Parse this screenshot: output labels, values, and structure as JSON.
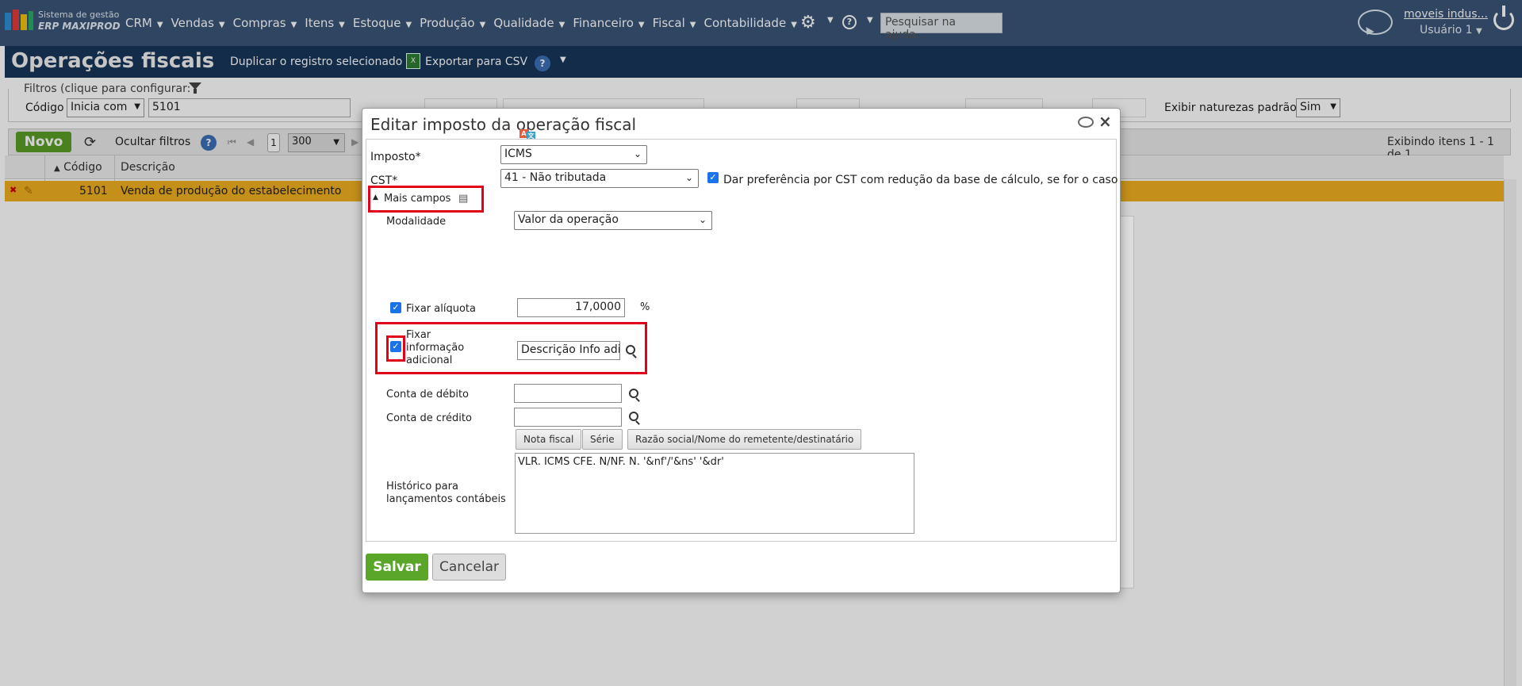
{
  "app": {
    "logo_line1": "Sistema de gestão",
    "logo_line2": "ERP MAXIPROD",
    "menu": [
      "CRM",
      "Vendas",
      "Compras",
      "Itens",
      "Estoque",
      "Produção",
      "Qualidade",
      "Financeiro",
      "Fiscal",
      "Contabilidade"
    ],
    "help_search_placeholder": "Pesquisar na ajuda...",
    "company": "moveis indus...",
    "user": "Usuário 1"
  },
  "page": {
    "title": "Operações fiscais",
    "duplicate": "Duplicar o registro selecionado",
    "export_csv": "Exportar para CSV"
  },
  "filters": {
    "legend": "Filtros (clique para configurar:",
    "code_label": "Código",
    "code_op": "Inicia com",
    "code_value": "5101",
    "natureza_label": "Exibir naturezas padrão",
    "natureza_value": "Sim"
  },
  "toolbar": {
    "new": "Novo",
    "hide_filters": "Ocultar filtros",
    "page": "1",
    "per_page": "300",
    "showing": "Exibindo itens 1 - 1 de 1"
  },
  "table": {
    "col_code": "Código",
    "col_desc": "Descrição",
    "rows": [
      {
        "code": "5101",
        "desc": "Venda de produção do estabelecimento"
      }
    ]
  },
  "dialog": {
    "title": "Editar imposto da operação fiscal",
    "imposto_label": "Imposto*",
    "imposto_value": "ICMS",
    "cst_label": "CST*",
    "cst_value": "41 - Não tributada",
    "cst_pref": "Dar preferência por CST com redução da base de cálculo, se for o caso",
    "more_fields": "Mais campos",
    "modalidade_label": "Modalidade",
    "modalidade_value": "Valor da operação",
    "fix_rate_label": "Fixar alíquota",
    "rate_value": "17,0000",
    "rate_unit": "%",
    "fix_info_l1": "Fixar",
    "fix_info_l2": "informação",
    "fix_info_l3": "adicional",
    "info_value": "Descrição Info adic",
    "debit_label": "Conta de débito",
    "credit_label": "Conta de crédito",
    "btn_nf": "Nota fiscal",
    "btn_serie": "Série",
    "btn_razao": "Razão social/Nome do remetente/destinatário",
    "hist_l1": "Histórico para",
    "hist_l2": "lançamentos contábeis",
    "hist_value": "VLR. ICMS CFE. N/NF. N. '&nf'/'&ns' '&dr'",
    "save": "Salvar",
    "cancel": "Cancelar"
  }
}
